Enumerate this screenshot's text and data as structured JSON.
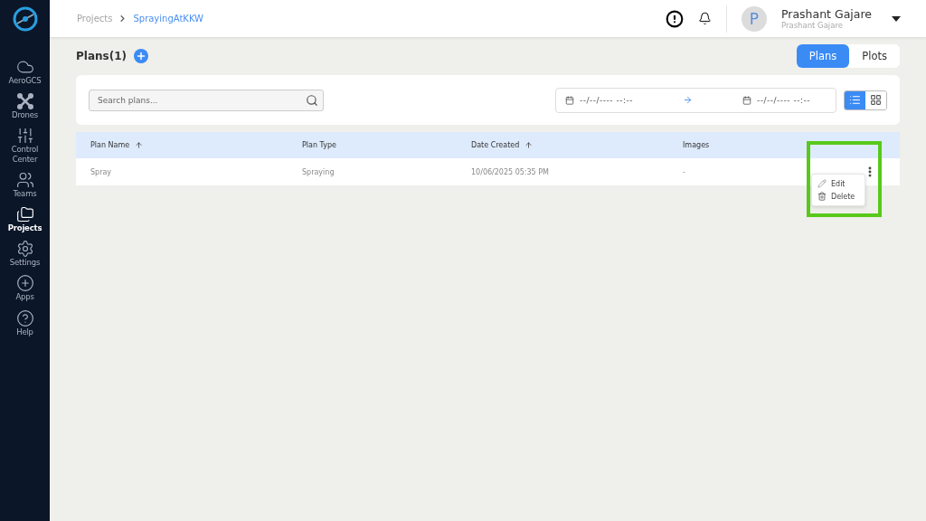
{
  "sidebar": {
    "items": [
      {
        "label": "AeroGCS",
        "kind": "cloud",
        "selected": false
      },
      {
        "label": "Drones",
        "kind": "drone",
        "selected": false
      },
      {
        "label": "Control Center",
        "kind": "sliders",
        "selected": false
      },
      {
        "label": "Teams",
        "kind": "team",
        "selected": false
      },
      {
        "label": "Projects",
        "kind": "folder",
        "selected": true
      },
      {
        "label": "Settings",
        "kind": "gear",
        "selected": false
      },
      {
        "label": "Apps",
        "kind": "plus",
        "selected": false
      },
      {
        "label": "Help",
        "kind": "help",
        "selected": false
      }
    ]
  },
  "breadcrumb": [
    "Projects",
    "SprayingAtKKW"
  ],
  "user": {
    "initial": "P",
    "name": "Prashant Gajare",
    "subtitle": "Prashant Gajare"
  },
  "title": "Plans(1)",
  "tabs": [
    {
      "label": "Plans",
      "selected": true
    },
    {
      "label": "Plots",
      "selected": false
    }
  ],
  "search": {
    "placeholder": "Search plans..."
  },
  "date_range": {
    "from": "--/--/---- --:--",
    "to": "--/--/---- --:--"
  },
  "view_modes": [
    {
      "kind": "list",
      "selected": true
    },
    {
      "kind": "grid",
      "selected": false
    }
  ],
  "table": {
    "columns": [
      {
        "label": "Plan Name",
        "sortable": true
      },
      {
        "label": "Plan Type",
        "sortable": false
      },
      {
        "label": "Date Created",
        "sortable": true
      },
      {
        "label": "Images",
        "sortable": false
      }
    ],
    "rows": [
      {
        "cells": [
          "Spray",
          "Spraying",
          "10/06/2025 05:35 PM",
          "-"
        ]
      }
    ]
  },
  "row_menu": {
    "open": true,
    "highlighted": true,
    "items": [
      {
        "kind": "edit",
        "label": "Edit"
      },
      {
        "kind": "delete",
        "label": "Delete"
      }
    ]
  }
}
